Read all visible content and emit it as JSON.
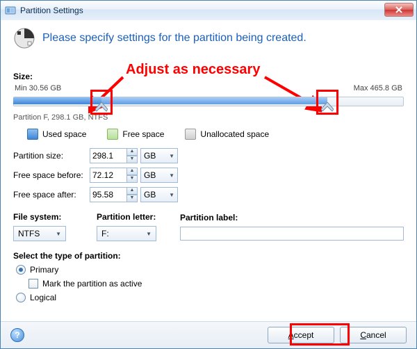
{
  "window": {
    "title": "Partition Settings"
  },
  "header": {
    "heading": "Please specify settings for the partition being created."
  },
  "annotation": {
    "text": "Adjust as necessary"
  },
  "size": {
    "label": "Size:",
    "min_label": "Min 30.56 GB",
    "max_label": "Max 465.8 GB",
    "partition_caption": "Partition F, 298.1 GB, NTFS"
  },
  "legend": {
    "used": "Used space",
    "free": "Free space",
    "unallocated": "Unallocated space"
  },
  "fields": {
    "partition_size": {
      "label": "Partition size:",
      "value": "298.1",
      "unit": "GB"
    },
    "free_before": {
      "label": "Free space before:",
      "value": "72.12",
      "unit": "GB"
    },
    "free_after": {
      "label": "Free space after:",
      "value": "95.58",
      "unit": "GB"
    }
  },
  "fs": {
    "file_system_label": "File system:",
    "file_system_value": "NTFS",
    "letter_label": "Partition letter:",
    "letter_value": "F:",
    "part_label_label": "Partition label:",
    "part_label_value": ""
  },
  "type": {
    "header": "Select the type of partition:",
    "primary": "Primary",
    "mark_active": "Mark the partition as active",
    "logical": "Logical",
    "selected": "primary",
    "active_checked": false
  },
  "footer": {
    "accept": "Accept",
    "cancel": "Cancel"
  }
}
